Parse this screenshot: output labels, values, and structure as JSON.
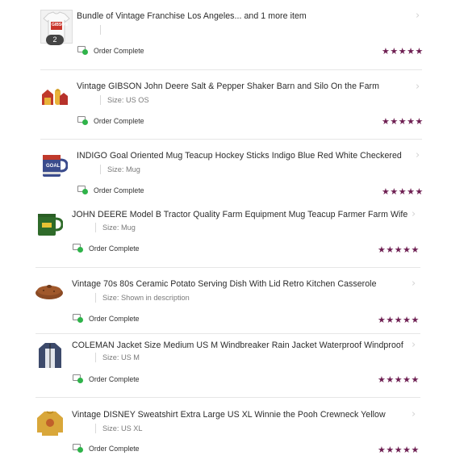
{
  "orders": [
    {
      "title": "Bundle of Vintage Franchise Los Angeles... and 1 more item",
      "meta": "",
      "status": "Order Complete",
      "badge": "2",
      "thumb_logo": "GIBSON",
      "rating": "★★★★★"
    },
    {
      "title": "Vintage GIBSON John Deere Salt & Pepper Shaker Barn and Silo On the Farm",
      "meta": "Size: US OS",
      "status": "Order Complete",
      "rating": "★★★★★"
    },
    {
      "title": "INDIGO Goal Oriented Mug Teacup Hockey Sticks Indigo Blue Red White Checkered",
      "meta": "Size: Mug",
      "status": "Order Complete",
      "thumb_text": "GOAL",
      "rating": "★★★★★"
    },
    {
      "title": "JOHN DEERE Model B Tractor Quality Farm Equipment Mug Teacup Farmer Farm Wife",
      "meta": "Size: Mug",
      "status": "Order Complete",
      "rating": "★★★★★"
    },
    {
      "title": "Vintage 70s 80s Ceramic Potato Serving Dish With Lid Retro Kitchen Casserole",
      "meta": "Size: Shown in description",
      "status": "Order Complete",
      "rating": "★★★★★"
    },
    {
      "title": "COLEMAN Jacket Size Medium US M Windbreaker Rain Jacket Waterproof Windproof",
      "meta": "Size: US M",
      "status": "Order Complete",
      "rating": "★★★★★"
    },
    {
      "title": "Vintage DISNEY Sweatshirt Extra Large US XL Winnie the Pooh Crewneck Yellow",
      "meta": "Size: US XL",
      "status": "Order Complete",
      "rating": "★★★★★"
    }
  ],
  "icons": {
    "status": "order-complete-icon",
    "chevron": "chevron-right-icon"
  },
  "colors": {
    "stars": "#6e1f52",
    "status_dot": "#2fb34a",
    "divider": "#e6e6e6"
  }
}
